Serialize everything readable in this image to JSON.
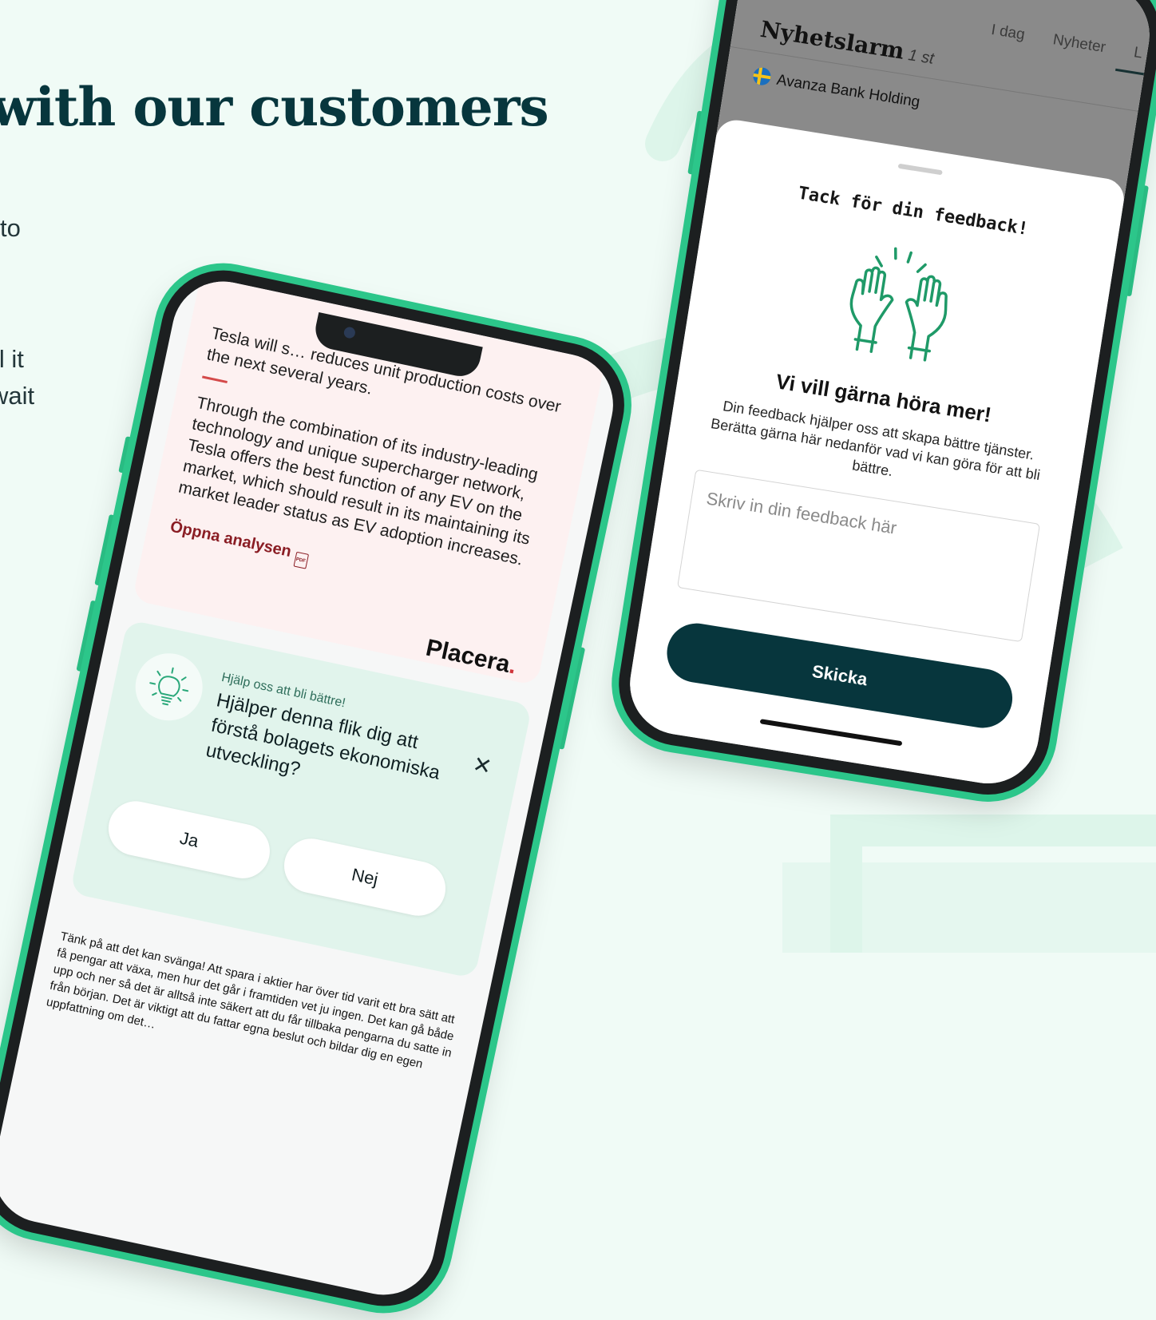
{
  "page": {
    "heading": "with our customers",
    "body_fragments": [
      "to",
      "ll it",
      "wait"
    ]
  },
  "colors": {
    "brand_green": "#2cc68a",
    "dark_teal": "#07363d",
    "bg_mint": "#f0fbf6"
  },
  "left_phone": {
    "analysis": {
      "intro": "Tesla will s… reduces unit production costs over the next several years.",
      "paragraph": "Through the combination of its industry-leading technology and unique supercharger network, Tesla offers the best function of any EV on the market, which should result in its maintaining its market leader status as EV adoption increases.",
      "open_link": "Öppna analysen",
      "pdf_icon": "PDF"
    },
    "brand": {
      "name": "Placera",
      "dot": "."
    },
    "feedback": {
      "icon": "lightbulb-icon",
      "small_label": "Hjälp oss att bli bättre!",
      "question": "Hjälper denna flik dig att förstå bolagets ekonomiska utveckling?",
      "close": "✕",
      "yes_label": "Ja",
      "no_label": "Nej"
    },
    "disclaimer": "Tänk på att det kan svänga! Att spara i aktier har över tid varit ett bra sätt att få pengar att växa, men hur det går i framtiden vet ju ingen. Det kan gå både upp och ner så det är alltså inte säkert att du får tillbaka pengarna du satte in från början. Det är viktigt att du fattar egna beslut och bildar dig en egen uppfattning om det…"
  },
  "right_phone": {
    "tabs": [
      "I dag",
      "Nyheter",
      "L"
    ],
    "news_alarm": {
      "title": "Nyhetslarm",
      "count": "1 st",
      "item": "Avanza Bank Holding"
    },
    "sheet": {
      "title": "Tack för din feedback!",
      "icon": "high-five-hands-icon",
      "subtitle": "Vi vill gärna höra mer!",
      "text": "Din feedback hjälper oss att skapa bättre tjänster. Berätta gärna här nedanför vad vi kan göra för att bli bättre.",
      "input_placeholder": "Skriv in din feedback här",
      "send_label": "Skicka"
    }
  }
}
